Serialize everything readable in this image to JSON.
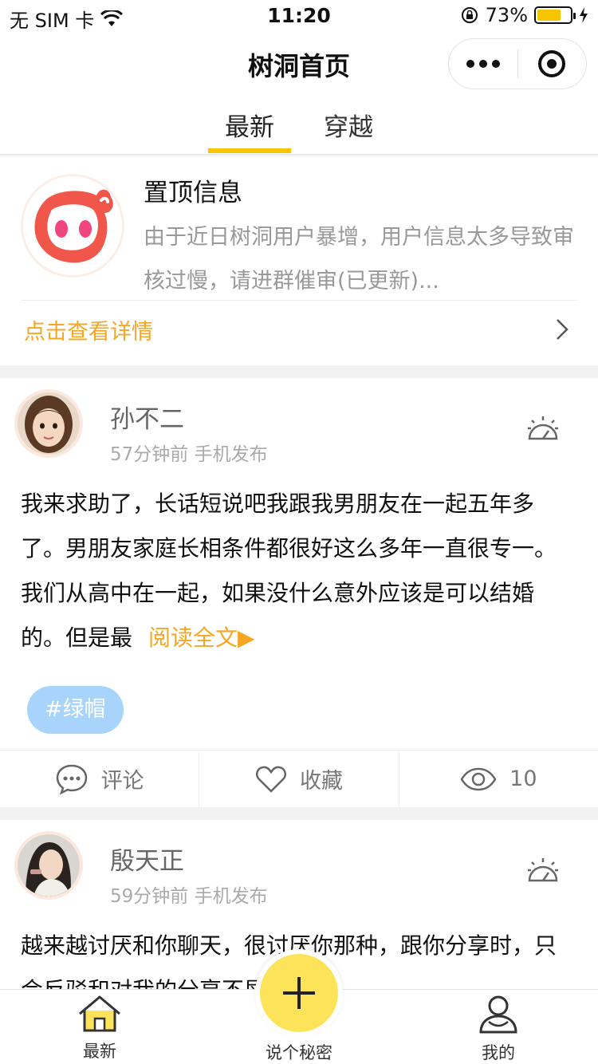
{
  "status_bar": {
    "carrier": "无 SIM 卡",
    "time": "11:20",
    "battery_percent": "73%",
    "battery_level": 0.73
  },
  "nav": {
    "title": "树洞首页"
  },
  "tabs": [
    {
      "label": "最新",
      "active": true
    },
    {
      "label": "穿越",
      "active": false
    }
  ],
  "pinned": {
    "title": "置顶信息",
    "description": "由于近日树洞用户暴增，用户信息太多导致审核过慢，请进群催审(已更新)...",
    "link": "点击查看详情"
  },
  "posts": [
    {
      "author": "孙不二",
      "meta": "57分钟前  手机发布",
      "body": "我来求助了，长话短说吧我跟我男朋友在一起五年多了。男朋友家庭长相条件都很好这么多年一直很专一。我们从高中在一起，如果没什么意外应该是可以结婚的。但是最",
      "read_more": "阅读全文▶",
      "tag": "#绿帽",
      "actions": {
        "comment": "评论",
        "favorite": "收藏",
        "views": "10"
      }
    },
    {
      "author": "殷天正",
      "meta": "59分钟前  手机发布",
      "body": "越来越讨厌和你聊天，很讨厌你那种，跟你分享时，只会反驳和对我的分享不屑的态度"
    }
  ],
  "tabbar": {
    "home": "最新",
    "post": "说个秘密",
    "mine": "我的"
  },
  "colors": {
    "accent": "#f7c500",
    "link": "#f5a623",
    "tag_bg": "#a8d4fb",
    "fab": "#fde35a"
  }
}
